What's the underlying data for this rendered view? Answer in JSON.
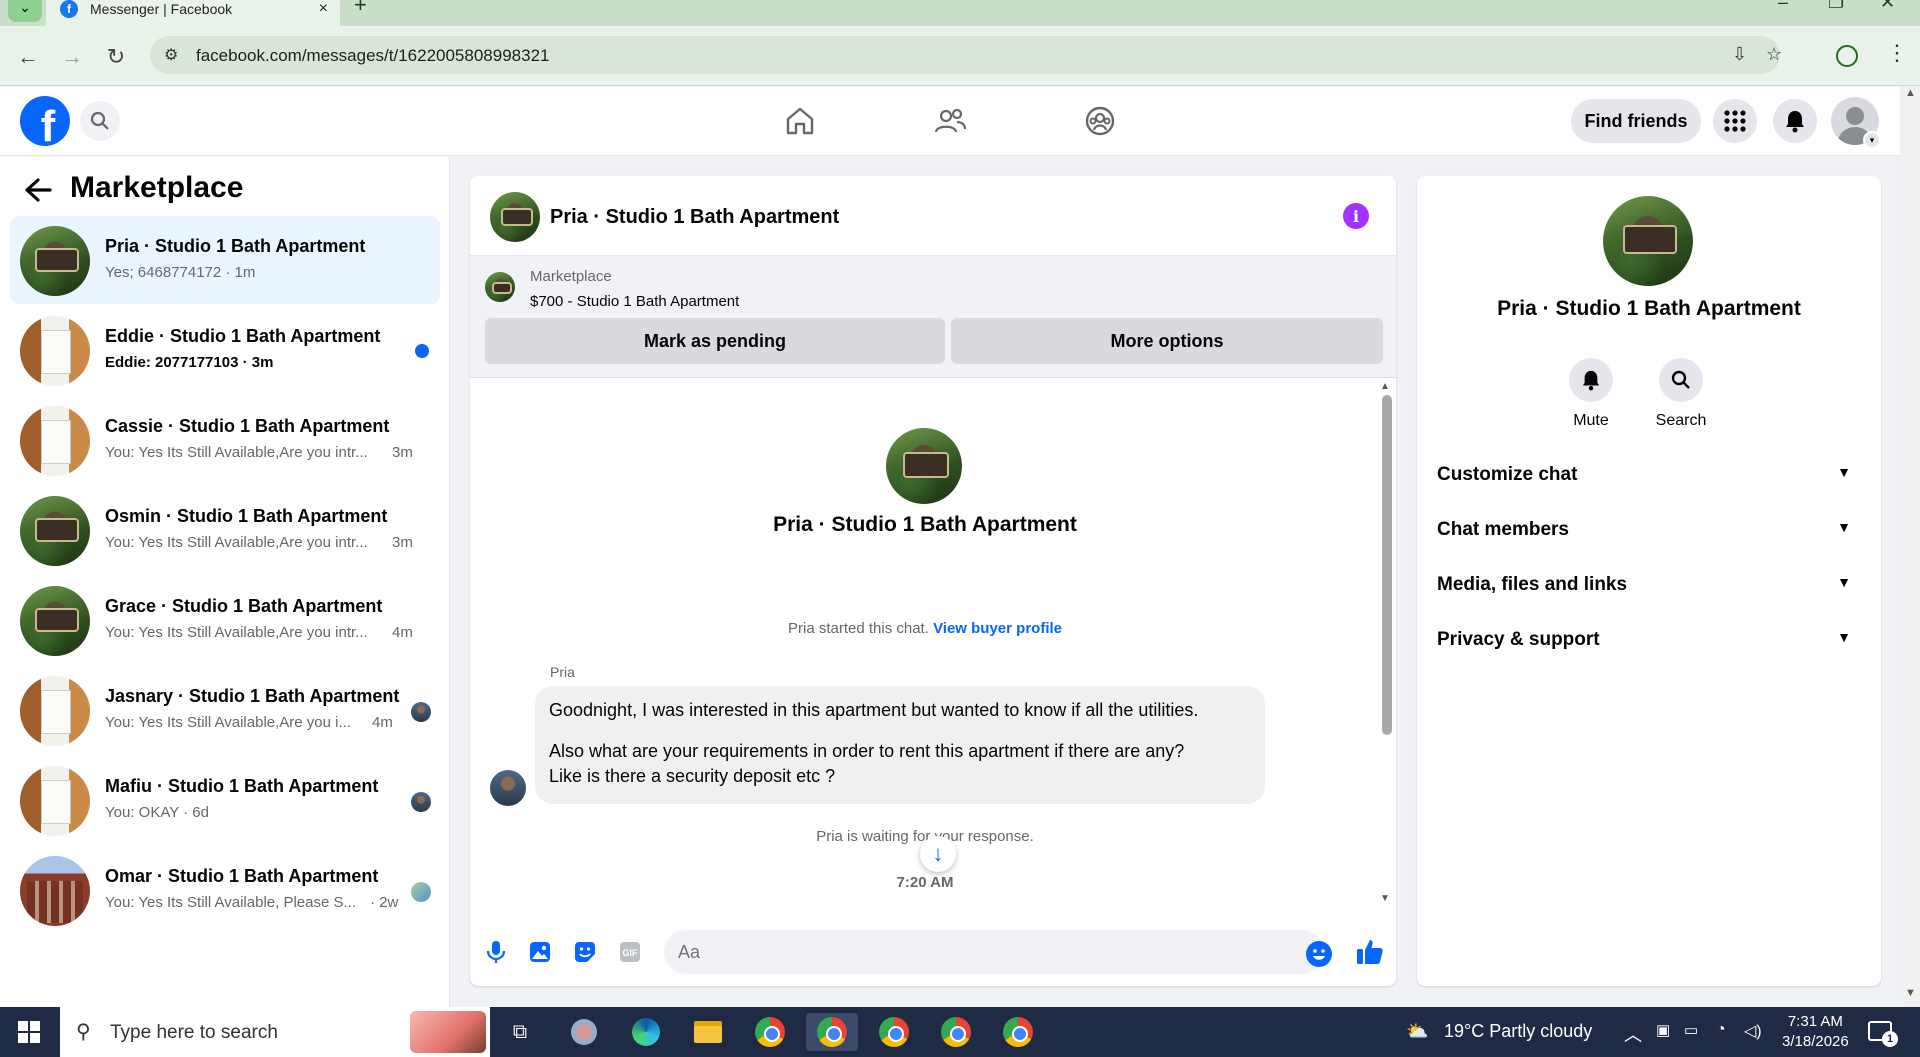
{
  "browser": {
    "tab_title": "Messenger | Facebook",
    "url": "facebook.com/messages/t/1622005808998321",
    "favicon_letter": "f",
    "new_tab_symbol": "+",
    "tab_close_symbol": "×"
  },
  "fb_header": {
    "logo_letter": "f",
    "find_friends_label": "Find friends"
  },
  "left_panel": {
    "title": "Marketplace",
    "conversations": [
      {
        "name": "Pria · Studio 1 Bath Apartment",
        "preview": "Yes; 6468774172 · 1m",
        "time": "",
        "thumb": "gardens",
        "active": true
      },
      {
        "name": "Eddie · Studio 1 Bath Apartment",
        "preview": "Eddie: 2077177103 · 3m",
        "time": "",
        "thumb": "kitchen",
        "unread": true
      },
      {
        "name": "Cassie · Studio 1 Bath Apartment",
        "preview": "You: Yes Its Still Available,Are you intr...",
        "time": "3m",
        "thumb": "kitchen"
      },
      {
        "name": "Osmin · Studio 1 Bath Apartment",
        "preview": "You: Yes Its Still Available,Are you intr...",
        "time": "3m",
        "thumb": "gardens"
      },
      {
        "name": "Grace · Studio 1 Bath Apartment",
        "preview": "You: Yes Its Still Available,Are you intr...",
        "time": "4m",
        "thumb": "gardens"
      },
      {
        "name": "Jasnary · Studio 1 Bath Apartment",
        "preview": "You: Yes Its Still Available,Are you i...",
        "time": "4m",
        "thumb": "kitchen"
      },
      {
        "name": "Mafiu · Studio 1 Bath Apartment",
        "preview": "You: OKAY · 6d",
        "time": "",
        "thumb": "kitchen"
      },
      {
        "name": "Omar · Studio 1 Bath Apartment",
        "preview": "You: Yes Its Still Available, Please S...",
        "time": "· 2w",
        "thumb": "brick"
      }
    ]
  },
  "chat": {
    "title": "Pria · Studio 1 Bath Apartment",
    "marketplace_label": "Marketplace",
    "listing": "$700 - Studio 1 Bath Apartment",
    "mark_pending_label": "Mark as pending",
    "more_options_label": "More options",
    "profile_name": "Pria · Studio 1 Bath Apartment",
    "started_text": "Pria started this chat.",
    "view_buyer_profile": "View buyer profile",
    "sender": "Pria",
    "message_line1": "Goodnight, I was interested in this apartment but wanted to know if all the utilities.",
    "message_line2": "Also what are your requirements in order to rent this apartment if there are any?",
    "message_line3": "Like is there a security deposit etc ?",
    "waiting_text": "Pria is waiting for your response.",
    "timestamp": "7:20 AM",
    "input_placeholder": "Aa"
  },
  "right_panel": {
    "name": "Pria · Studio 1 Bath Apartment",
    "mute_label": "Mute",
    "search_label": "Search",
    "sections": [
      "Customize chat",
      "Chat members",
      "Media, files and links",
      "Privacy & support"
    ]
  },
  "taskbar": {
    "search_placeholder": "Type here to search",
    "weather": "19°C  Partly cloudy",
    "time": "7:31 AM",
    "date": "3/18/2026",
    "notification_count": "1"
  },
  "colors": {
    "accent": "#0866ff",
    "info_purple": "#a033ff",
    "active_row": "#ebf5ff"
  }
}
